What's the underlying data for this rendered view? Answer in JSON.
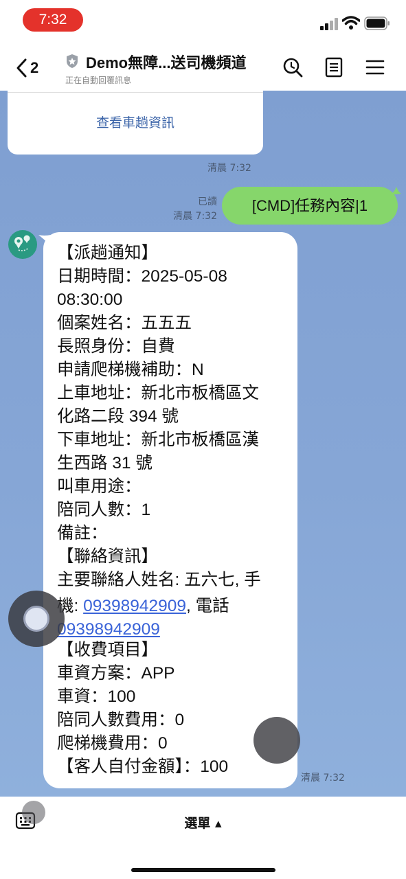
{
  "status": {
    "time": "7:32"
  },
  "header": {
    "back_count": "2",
    "title": "Demo無障...送司機頻道",
    "subtitle": "正在自動回覆訊息"
  },
  "icons": {
    "back": "chevron-left-icon",
    "shield": "shield-icon",
    "search": "search-icon",
    "notes": "notes-icon",
    "menu": "hamburger-menu-icon",
    "keyboard": "keyboard-icon"
  },
  "colors": {
    "status_pill": "#e4322b",
    "chat_bg": "#86a6d6",
    "outgoing_bubble": "#86d66b",
    "link": "#3a63d8"
  },
  "chat": {
    "card_link": "查看車趟資訊",
    "card_time": "清晨 7:32",
    "out_read": "已讀",
    "out_time": "清晨 7:32",
    "out_message": "[CMD]任務內容|1",
    "in_time": "清晨 7:32",
    "in_lines": [
      "【派趟通知】",
      "日期時間：2025-05-08",
      "08:30:00",
      "個案姓名：五五五",
      "長照身份：自費",
      "申請爬梯機補助：N",
      "上車地址：新北市板橋區文",
      "化路二段 394 號",
      "下車地址：新北市板橋區漢",
      "生西路 31 號",
      "叫車用途：",
      "陪同人數：1",
      "備註：",
      "【聯絡資訊】",
      "主要聯絡人姓名: 五六七, 手"
    ],
    "phone_prefix": "機: ",
    "phone": "09398942909",
    "phone_suffix": ", 電話",
    "phone2": "09398942909",
    "in_lines2": [
      "【收費項目】",
      "車資方案：APP",
      "車資：100",
      "陪同人數費用：0",
      "爬梯機費用：0",
      "【客人自付金額】：100"
    ]
  },
  "bottom": {
    "menu_label": "選單 ▴"
  }
}
